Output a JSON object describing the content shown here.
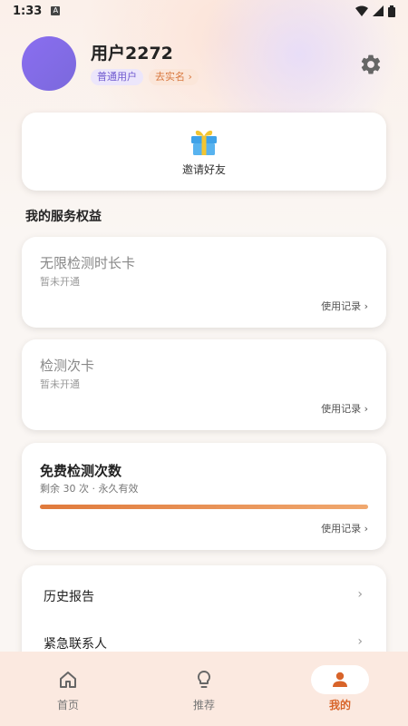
{
  "status_bar": {
    "time": "1:33"
  },
  "profile": {
    "username": "用户2272",
    "tag_member": "普通用户",
    "tag_verify": "去实名 ›"
  },
  "invite": {
    "label": "邀请好友"
  },
  "services": {
    "section_title": "我的服务权益",
    "cards": [
      {
        "title": "无限检测时长卡",
        "subtitle": "暂未开通",
        "link": "使用记录 ›"
      },
      {
        "title": "检测次卡",
        "subtitle": "暂未开通",
        "link": "使用记录 ›"
      },
      {
        "title": "免费检测次数",
        "subtitle": "剩余 30 次 · 永久有效",
        "link": "使用记录 ›",
        "progress": 1.0
      }
    ]
  },
  "menu": [
    {
      "label": "历史报告",
      "arrow": "›"
    },
    {
      "label": "紧急联系人",
      "arrow": "›"
    }
  ],
  "bottom_nav": [
    {
      "label": "首页",
      "icon": "home-icon"
    },
    {
      "label": "推荐",
      "icon": "lightbulb-icon"
    },
    {
      "label": "我的",
      "icon": "person-icon",
      "active": true
    }
  ],
  "colors": {
    "accent": "#d8642a",
    "avatar": "#7b69dc"
  }
}
